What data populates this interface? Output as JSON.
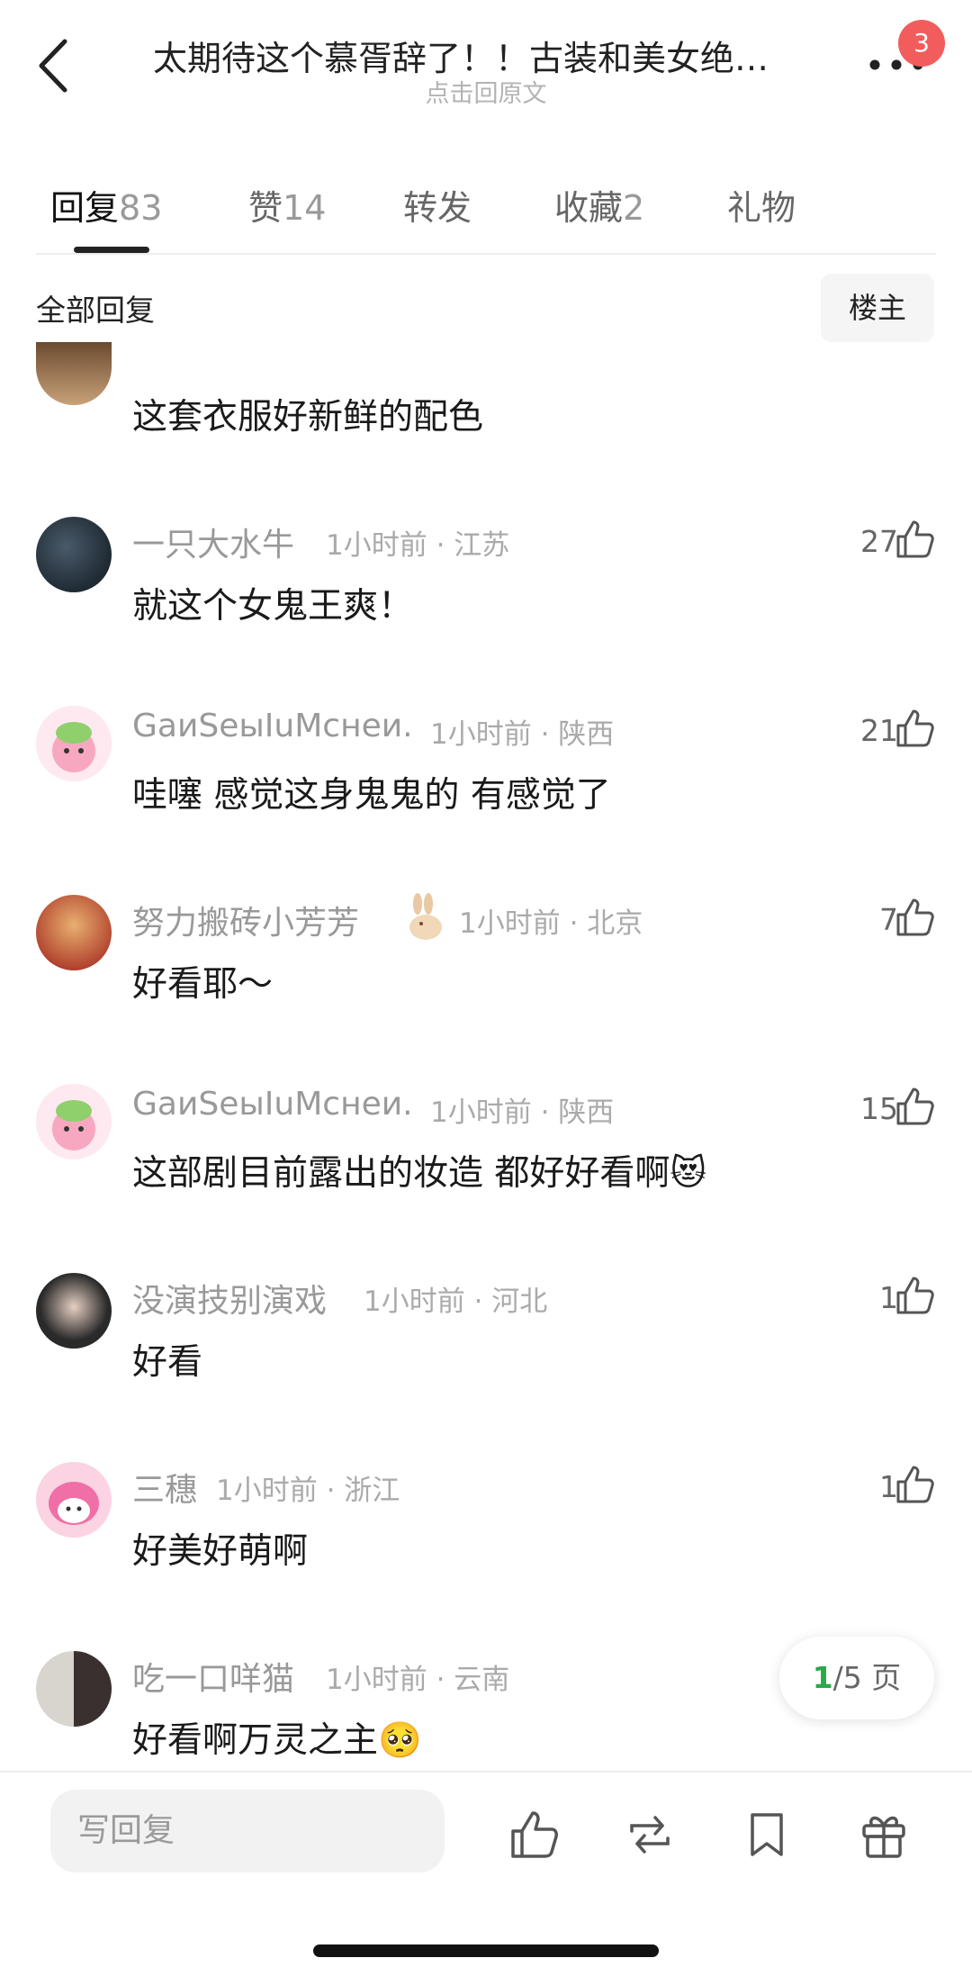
{
  "header": {
    "title": "太期待这个慕胥辞了！！古装和美女绝…",
    "subtitle": "点击回原文",
    "badge": "3"
  },
  "tabs": [
    {
      "label": "回复",
      "count": "83"
    },
    {
      "label": "赞",
      "count": "14"
    },
    {
      "label": "转发",
      "count": ""
    },
    {
      "label": "收藏",
      "count": "2"
    },
    {
      "label": "礼物",
      "count": ""
    }
  ],
  "filter": {
    "title": "全部回复",
    "owner_button": "楼主"
  },
  "comments": [
    {
      "name": "",
      "meta": "",
      "text": "这套衣服好新鲜的配色",
      "likes": ""
    },
    {
      "name": "一只大水牛",
      "meta": "1小时前 · 江苏",
      "text": "就这个女鬼王爽！",
      "likes": "27"
    },
    {
      "name": "GаиSеыIuМснеи.",
      "meta": "1小时前 · 陕西",
      "text": "哇噻 感觉这身鬼鬼的 有感觉了",
      "likes": "21"
    },
    {
      "name": "努力搬砖小芳芳",
      "meta": "1小时前 · 北京",
      "text": "好看耶～",
      "likes": "7"
    },
    {
      "name": "GаиSеыIuМснеи.",
      "meta": "1小时前 · 陕西",
      "text": "这部剧目前露出的妆造 都好好看啊😻",
      "likes": "15"
    },
    {
      "name": "没演技别演戏",
      "meta": "1小时前 · 河北",
      "text": "好看",
      "likes": "1"
    },
    {
      "name": "三穗",
      "meta": "1小时前 · 浙江",
      "text": "好美好萌啊",
      "likes": "1"
    },
    {
      "name": "吃一口咩猫",
      "meta": "1小时前 · 云南",
      "text": "好看啊万灵之主🥺",
      "likes": ""
    }
  ],
  "pager": {
    "current": "1",
    "total": "/5 页"
  },
  "bottom": {
    "reply_placeholder": "写回复"
  },
  "colors": {
    "accent_green": "#2aa84a",
    "badge_red": "#f25c5c"
  }
}
